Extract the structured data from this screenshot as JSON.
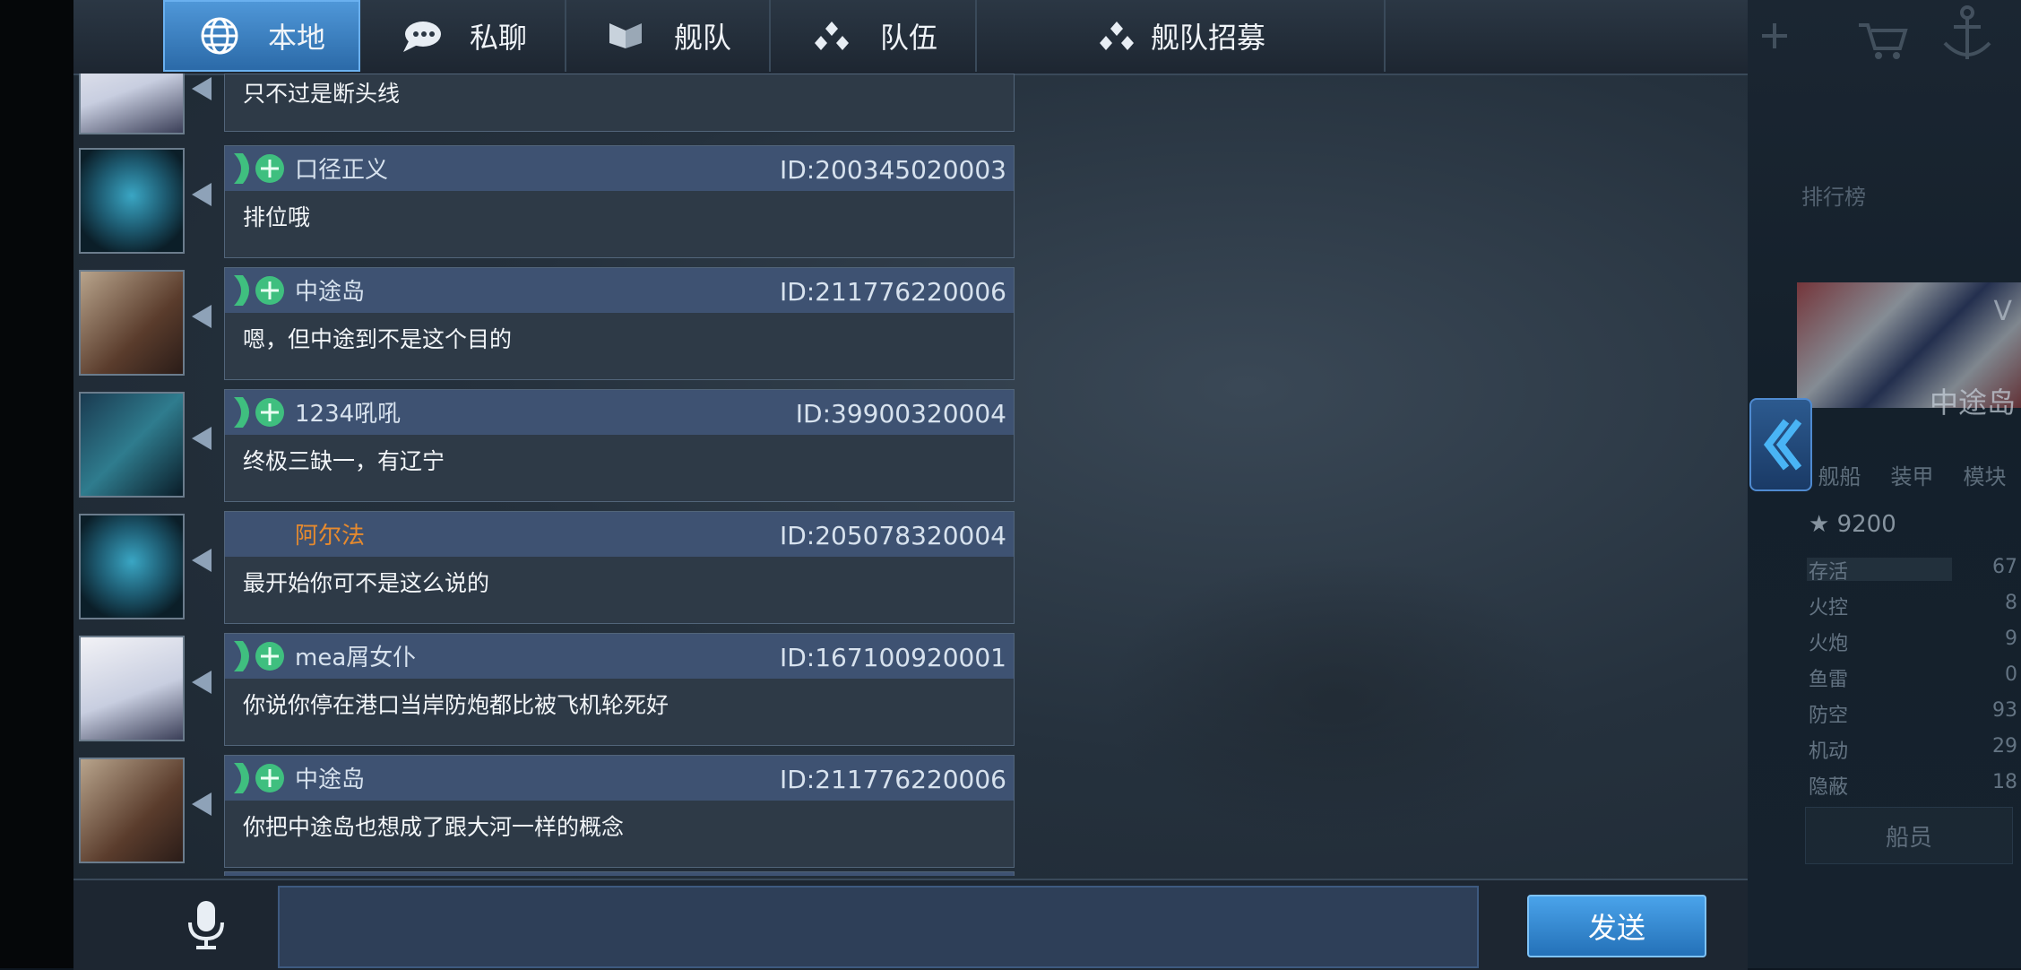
{
  "tabs": [
    {
      "label": "本地",
      "icon": "globe-icon",
      "active": true
    },
    {
      "label": "私聊",
      "icon": "chat-bubble-icon",
      "active": false
    },
    {
      "label": "舰队",
      "icon": "fleet-flag-icon",
      "active": false
    },
    {
      "label": "队伍",
      "icon": "team-dots-icon",
      "active": false
    },
    {
      "label": "舰队招募",
      "icon": "team-dots-icon",
      "active": false
    }
  ],
  "messages": [
    {
      "text": "只不过是断头线",
      "partial": true
    },
    {
      "name": "口径正义",
      "id": "ID:200345020003",
      "text": "排位哦",
      "name_color": "default"
    },
    {
      "name": "中途岛",
      "id": "ID:211776220006",
      "text": "嗯，但中途到不是这个目的",
      "name_color": "default"
    },
    {
      "name": "1234吼吼",
      "id": "ID:39900320004",
      "text": "终极三缺一，有辽宁",
      "name_color": "default"
    },
    {
      "name": "阿尔法",
      "id": "ID:205078320004",
      "text": "最开始你可不是这么说的",
      "name_color": "orange"
    },
    {
      "name": "mea屑女仆",
      "id": "ID:167100920001",
      "text": "你说你停在港口当岸防炮都比被飞机轮死好",
      "name_color": "default"
    },
    {
      "name": "中途岛",
      "id": "ID:211776220006",
      "text": "你把中途岛也想成了跟大河一样的概念",
      "name_color": "default"
    }
  ],
  "input": {
    "value": "",
    "send_label": "发送"
  },
  "colors": {
    "accent": "#3d8fd6",
    "orange_name": "#e68a2e",
    "header_bg": "#3e5272"
  },
  "right_panel": {
    "rank_label": "排行榜",
    "ship_name": "中途岛",
    "class_letter": "V",
    "tabs": [
      "舰船",
      "装甲",
      "模块"
    ],
    "score": "9200",
    "stats": [
      {
        "label": "存活",
        "value": "67"
      },
      {
        "label": "火控",
        "value": "8"
      },
      {
        "label": "火炮",
        "value": "9"
      },
      {
        "label": "鱼雷",
        "value": "0"
      },
      {
        "label": "防空",
        "value": "93"
      },
      {
        "label": "机动",
        "value": "29"
      },
      {
        "label": "隐蔽",
        "value": "18"
      }
    ],
    "crew_label": "船员"
  }
}
